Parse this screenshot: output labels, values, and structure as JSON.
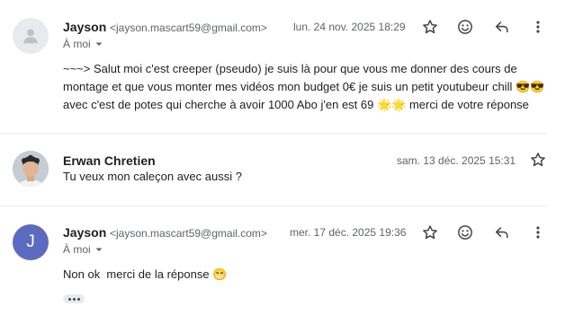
{
  "messages": [
    {
      "sender": "Jayson",
      "email": "<jayson.mascart59@gmail.com>",
      "to": "À moi",
      "date": "lun. 24 nov. 2025 18:29",
      "body_lines": [
        "~~~> Salut moi c'est creeper (pseudo) je suis là pour que vous me donner des cours de",
        "montage et que vous monter mes vidéos mon budget 0€ je suis un petit youtubeur chill 😎😎",
        "avec c'est de potes qui cherche à avoir 1000 Abo j'en est 69 🌟🌟 merci de votre réponse"
      ]
    },
    {
      "sender": "Erwan Chretien",
      "date": "sam. 13 déc. 2025 15:31",
      "body": "Tu veux mon caleçon avec aussi ?"
    },
    {
      "sender": "Jayson",
      "avatar_letter": "J",
      "email": "<jayson.mascart59@gmail.com>",
      "to": "À moi",
      "date": "mer. 17 déc. 2025 19:36",
      "body": "Non ok  merci de la réponse 😁"
    }
  ],
  "colors": {
    "avatar_j": "#5c6bc0",
    "avatar_default": "#e8eaed",
    "icon": "#444746"
  },
  "icons": [
    "person-icon",
    "star-icon",
    "emoji-icon",
    "reply-icon",
    "more-vert-icon",
    "chevron-down-icon"
  ]
}
